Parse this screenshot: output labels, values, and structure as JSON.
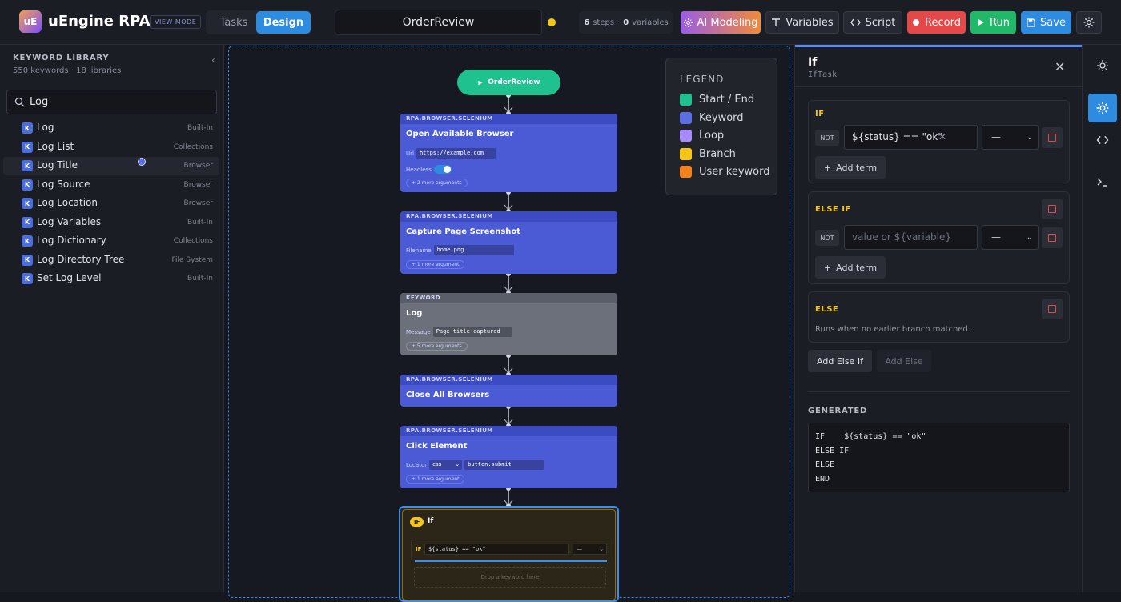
{
  "app": {
    "logo": "uE",
    "name": "uEngine RPA",
    "mode_badge": "VIEW MODE"
  },
  "tabs": {
    "tasks": "Tasks",
    "design": "Design"
  },
  "document": {
    "name": "OrderReview"
  },
  "stats": {
    "steps": "6",
    "steps_label": "steps",
    "sep": "·",
    "variables": "0",
    "variables_label": "variables"
  },
  "toolbar": {
    "ai": "AI Modeling",
    "variables": "Variables",
    "script": "Script",
    "record": "Record",
    "run": "Run",
    "save": "Save"
  },
  "library": {
    "title": "KEYWORD LIBRARY",
    "subtitle": "550 keywords · 18 libraries",
    "search_value": "Log",
    "items": [
      {
        "badge": "K",
        "name": "Log",
        "lib": "Built-In"
      },
      {
        "badge": "K",
        "name": "Log List",
        "lib": "Collections"
      },
      {
        "badge": "K",
        "name": "Log Title",
        "lib": "Browser"
      },
      {
        "badge": "K",
        "name": "Log Source",
        "lib": "Browser"
      },
      {
        "badge": "K",
        "name": "Log Location",
        "lib": "Browser"
      },
      {
        "badge": "K",
        "name": "Log Variables",
        "lib": "Built-In"
      },
      {
        "badge": "K",
        "name": "Log Dictionary",
        "lib": "Collections"
      },
      {
        "badge": "K",
        "name": "Log Directory Tree",
        "lib": "File System"
      },
      {
        "badge": "K",
        "name": "Set Log Level",
        "lib": "Built-In"
      }
    ]
  },
  "flow": {
    "start": "OrderReview",
    "cards": [
      {
        "lib": "RPA.BROWSER.SELENIUM",
        "title": "Open Available Browser",
        "arg1_label": "Url",
        "arg1_value": "https://example.com",
        "arg2_label": "Headless",
        "more": "+ 2 more arguments"
      },
      {
        "lib": "RPA.BROWSER.SELENIUM",
        "title": "Capture Page Screenshot",
        "arg1_label": "Filename",
        "arg1_value": "home.png",
        "more": "+ 1 more argument"
      },
      {
        "lib": "KEYWORD",
        "title": "Log",
        "arg1_label": "Message",
        "arg1_value": "Page title captured",
        "more": "+ 5 more arguments"
      },
      {
        "lib": "RPA.BROWSER.SELENIUM",
        "title": "Close All Browsers"
      },
      {
        "lib": "RPA.BROWSER.SELENIUM",
        "title": "Click Element",
        "arg1_label": "Locator",
        "arg1_select": "css",
        "arg1_value": "button.submit",
        "more": "+ 1 more argument"
      }
    ],
    "if_card": {
      "badge": "IF",
      "title": "If",
      "cond_label": "IF",
      "cond_value": "${status} == \"ok\"",
      "op": "—",
      "drop": "Drop a keyword here"
    }
  },
  "legend": {
    "title": "LEGEND",
    "items": [
      {
        "label": "Start / End",
        "color": "#1fc28e"
      },
      {
        "label": "Keyword",
        "color": "#5b6fe0"
      },
      {
        "label": "Loop",
        "color": "#a78bfa"
      },
      {
        "label": "Branch",
        "color": "#f5c518"
      },
      {
        "label": "User keyword",
        "color": "#f2821f"
      }
    ]
  },
  "inspector": {
    "title": "If",
    "subtitle": "IfTask",
    "if_label": "IF",
    "not": "NOT",
    "if_value": "${status} == \"ok\"",
    "op": "—",
    "add_term": "Add term",
    "elseif_label": "ELSE IF",
    "elseif_placeholder": "value or ${variable}",
    "else_label": "ELSE",
    "else_note": "Runs when no earlier branch matched.",
    "add_else_if": "Add Else If",
    "add_else": "Add Else",
    "generated_label": "GENERATED",
    "generated_code": "IF    ${status} == \"ok\"\nELSE IF\nELSE\nEND"
  }
}
